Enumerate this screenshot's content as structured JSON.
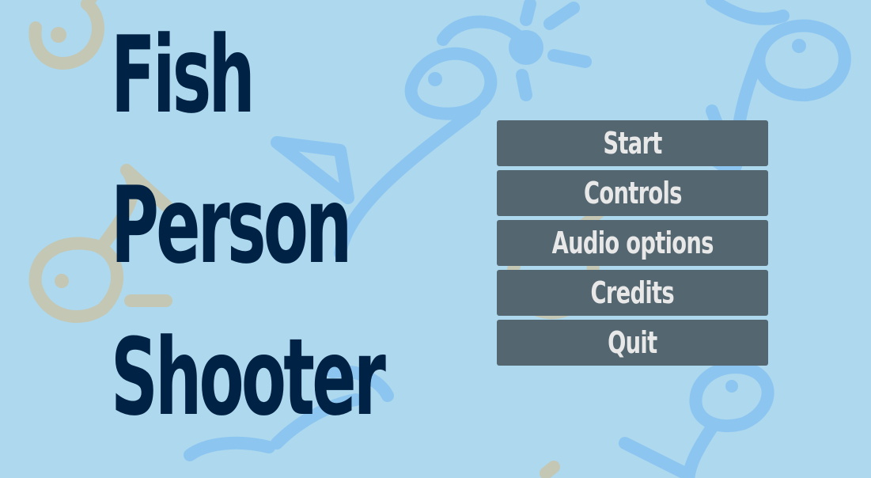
{
  "title": {
    "lines": [
      "Fish",
      "Person",
      "Shooter"
    ]
  },
  "menu": {
    "items": [
      {
        "label": "Start"
      },
      {
        "label": "Controls"
      },
      {
        "label": "Audio options"
      },
      {
        "label": "Credits"
      },
      {
        "label": "Quit"
      }
    ]
  },
  "colors": {
    "background": "#add8ee",
    "title_text": "#002244",
    "button_bg": "#546670",
    "button_text": "#e8e8e8",
    "doodle_blue": "#8cc6f0",
    "doodle_tan": "#c4c7b3"
  },
  "background_decoration": {
    "icon": "fish-doodle-icon",
    "description_colors": [
      "blue",
      "tan"
    ]
  }
}
